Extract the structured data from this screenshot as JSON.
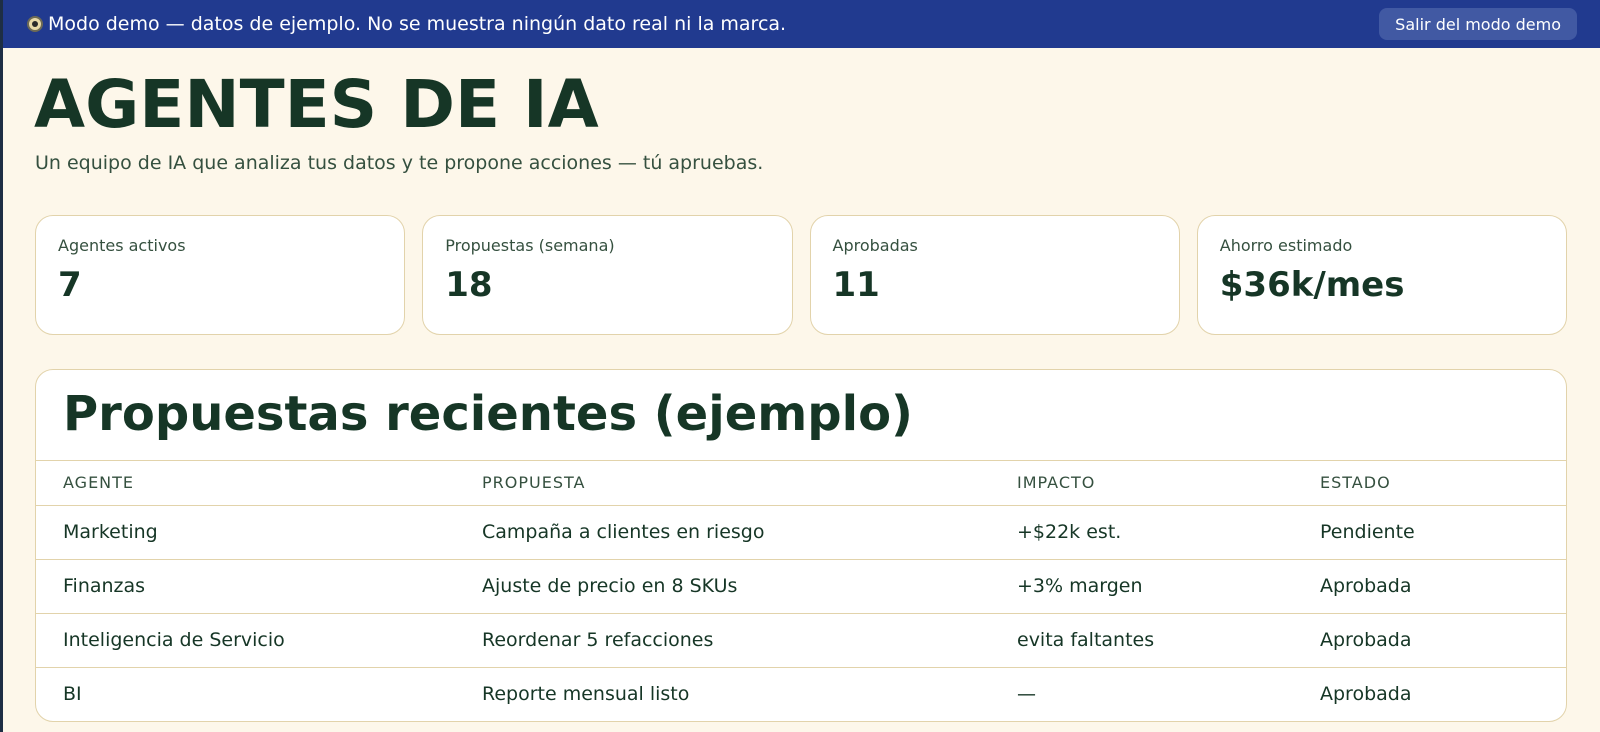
{
  "banner": {
    "message": "Modo demo — datos de ejemplo. No se muestra ningún dato real ni la marca.",
    "exit_label": "Salir del modo demo",
    "icon": "eye-icon"
  },
  "header": {
    "title": "AGENTES DE IA",
    "subtitle": "Un equipo de IA que analiza tus datos y te propone acciones — tú apruebas."
  },
  "stats": [
    {
      "label": "Agentes activos",
      "value": "7"
    },
    {
      "label": "Propuestas (semana)",
      "value": "18"
    },
    {
      "label": "Aprobadas",
      "value": "11"
    },
    {
      "label": "Ahorro estimado",
      "value": "$36k/mes"
    }
  ],
  "proposals": {
    "title": "Propuestas recientes (ejemplo)",
    "columns": [
      "AGENTE",
      "PROPUESTA",
      "IMPACTO",
      "ESTADO"
    ],
    "rows": [
      {
        "agent": "Marketing",
        "proposal": "Campaña a clientes en riesgo",
        "impact": "+$22k est.",
        "status": "Pendiente"
      },
      {
        "agent": "Finanzas",
        "proposal": "Ajuste de precio en 8 SKUs",
        "impact": "+3% margen",
        "status": "Aprobada"
      },
      {
        "agent": "Inteligencia de Servicio",
        "proposal": "Reordenar 5 refacciones",
        "impact": "evita faltantes",
        "status": "Aprobada"
      },
      {
        "agent": "BI",
        "proposal": "Reporte mensual listo",
        "impact": "—",
        "status": "Aprobada"
      }
    ]
  },
  "colors": {
    "banner_bg": "#213a8f",
    "page_bg": "#fdf7ea",
    "text_dark_green": "#163626",
    "card_border": "#e2d3ab"
  }
}
